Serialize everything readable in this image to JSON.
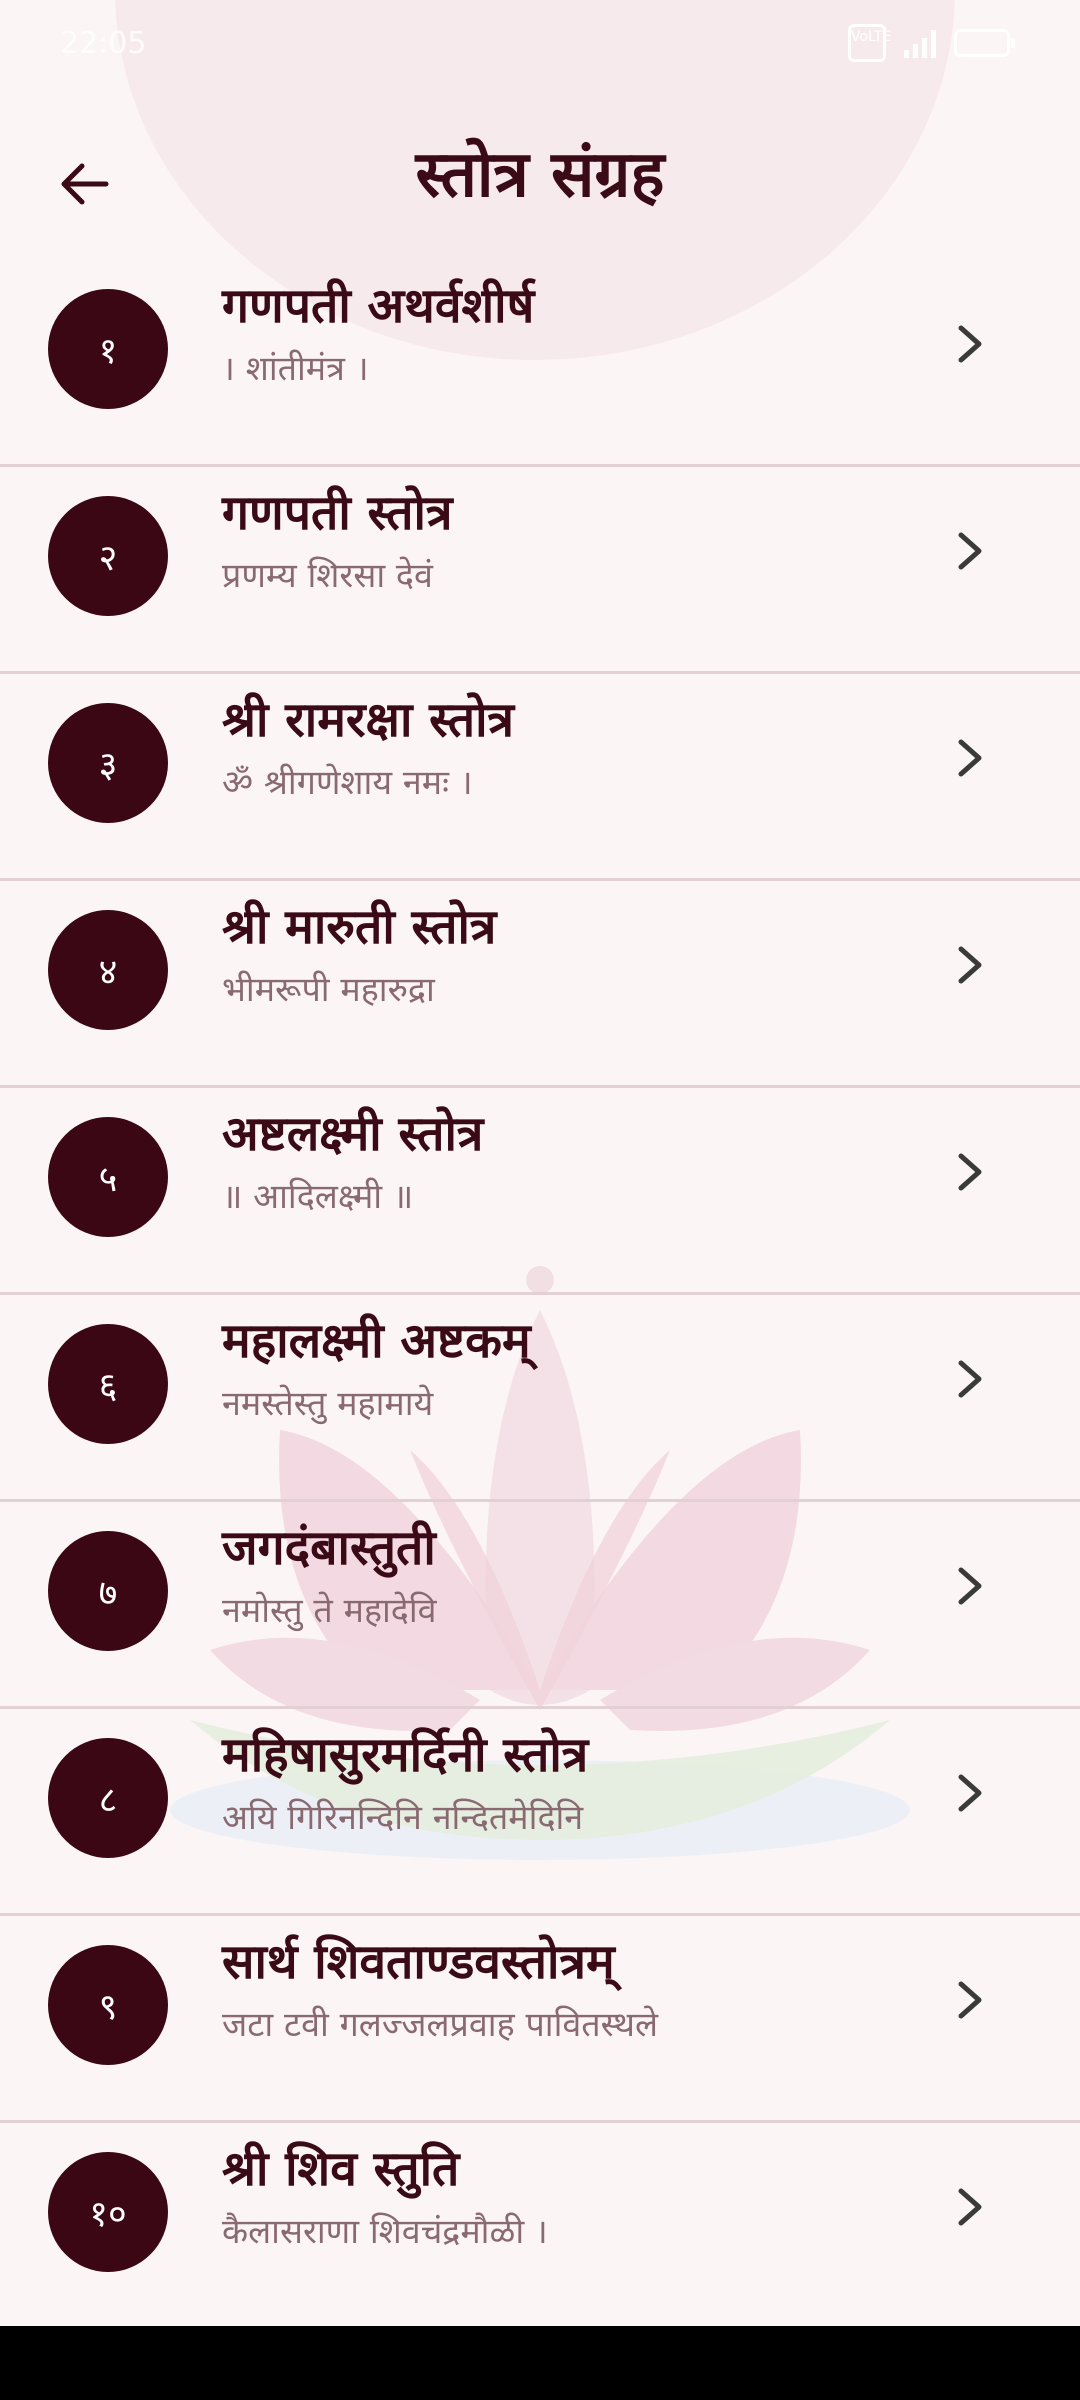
{
  "status_bar": {
    "time": "22:05",
    "network_badge": "VoLTE"
  },
  "header": {
    "title": "स्तोत्र संग्रह",
    "back_icon": "arrow-left-icon"
  },
  "items": [
    {
      "number": "१",
      "title": "गणपती अथर्वशीर्ष",
      "subtitle": "। शांतीमंत्र ।"
    },
    {
      "number": "२",
      "title": "गणपती स्तोत्र",
      "subtitle": "प्रणम्य शिरसा देवं"
    },
    {
      "number": "३",
      "title": "श्री रामरक्षा स्तोत्र",
      "subtitle": "ॐ श्रीगणेशाय नमः ।"
    },
    {
      "number": "४",
      "title": "श्री मारुती स्तोत्र",
      "subtitle": "भीमरूपी महारुद्रा"
    },
    {
      "number": "५",
      "title": "अष्टलक्ष्मी स्तोत्र",
      "subtitle": "॥ आदिलक्ष्मी ॥"
    },
    {
      "number": "६",
      "title": "महालक्ष्मी अष्टकम्",
      "subtitle": "नमस्तेस्तु महामाये"
    },
    {
      "number": "७",
      "title": "जगदंबास्तुती",
      "subtitle": "नमोस्तु ते महादेवि"
    },
    {
      "number": "८",
      "title": "महिषासुरमर्दिनी स्तोत्र",
      "subtitle": "अयि गिरिनन्दिनि नन्दितमेदिनि"
    },
    {
      "number": "९",
      "title": "सार्थ शिवताण्डवस्तोत्रम्",
      "subtitle": "जटा टवी गलज्जलप्रवाह पावितस्थले"
    },
    {
      "number": "१०",
      "title": "श्री शिव स्तुति",
      "subtitle": "कैलासराणा शिवचंद्रमौळी ।"
    }
  ],
  "colors": {
    "background": "#fbf5f5",
    "badge": "#3b0715",
    "title_text": "#3a0b17",
    "subtitle_text": "#8a6a72"
  },
  "icons": {
    "row_action": "chevron-right-icon",
    "decoration": "lotus-icon"
  }
}
